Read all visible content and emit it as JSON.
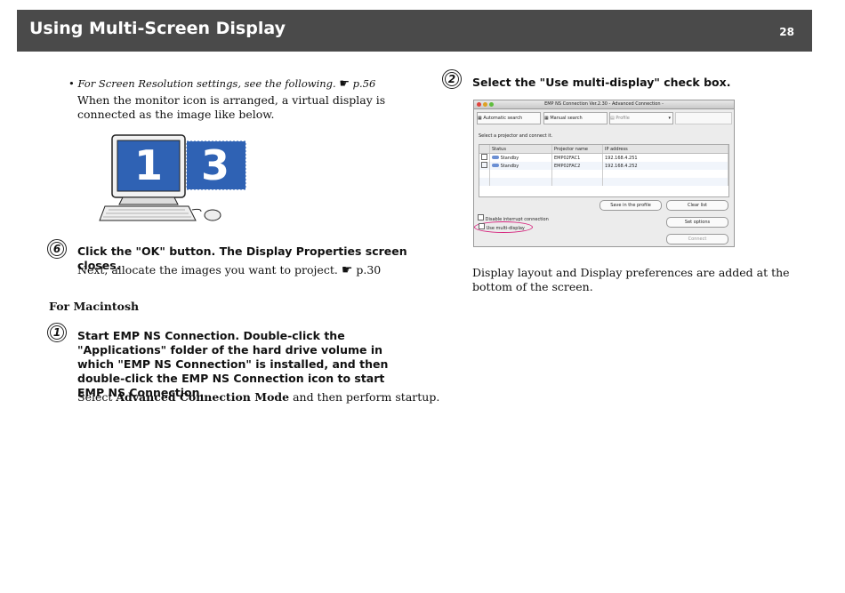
{
  "header": {
    "title": "Using Multi-Screen Display",
    "page_number": "28"
  },
  "left": {
    "bullet_text": "For Screen Resolution settings, see the following.",
    "bullet_ref": "p.56",
    "intro": "When the monitor icon is arranged, a virtual display is connected as the image like below.",
    "monitor_1": "1",
    "monitor_3": "3",
    "step6": {
      "number": "6",
      "title": "Click the \"OK\" button. The Display Properties screen closes.",
      "body": "Next, allocate the images you want to project.",
      "ref": "p.30"
    },
    "mac_heading": "For Macintosh",
    "step1": {
      "number": "1",
      "title": "Start EMP NS Connection. Double-click the \"Applications\" folder of the hard drive volume in which \"EMP NS Connection\" is installed, and then double-click the EMP NS Connection icon to start EMP NS Connection.",
      "body_pre": "Select ",
      "body_bold": "Advanced Connection Mode",
      "body_post": " and then perform startup."
    }
  },
  "right": {
    "step2": {
      "number": "2",
      "title": "Select the \"Use multi-display\" check box."
    },
    "caption": "Display layout and Display preferences are added at the bottom of the screen."
  },
  "app": {
    "title": "EMP NS Connection Ver.2.30 - Advanced Connection -",
    "auto_search": "Automatic search",
    "manual_search": "Manual search",
    "profile": "Profile",
    "select_label": "Select a projector and connect it.",
    "columns": [
      "Status",
      "Projector name",
      "IP address"
    ],
    "rows": [
      {
        "status": "Standby",
        "name": "EMP02FAC1",
        "ip": "192.168.4.251"
      },
      {
        "status": "Standby",
        "name": "EMP02FAC2",
        "ip": "192.168.4.252"
      }
    ],
    "save_profile": "Save in the profile",
    "clear_list": "Clear list",
    "disable_interrupt": "Disable interrupt connection",
    "use_multi": "Use multi-display",
    "set_options": "Set options",
    "connect": "Connect"
  }
}
